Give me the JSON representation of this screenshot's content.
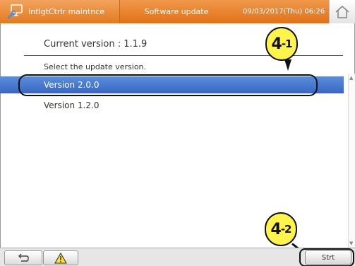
{
  "header": {
    "app_label": "IntlgtCtrlr maintnce",
    "screen_title": "Software update",
    "datetime": "09/03/2017(Thu) 06:26",
    "app_icon": "monitor-wrench-icon",
    "home_icon": "home-icon"
  },
  "main": {
    "current_version_text": "Current version : 1.1.9",
    "select_prompt": "Select the update version.",
    "versions": [
      {
        "label": "Version 2.0.0",
        "selected": true
      },
      {
        "label": "Version 1.2.0",
        "selected": false
      }
    ]
  },
  "annotations": {
    "callout_1": {
      "main": "4",
      "sub": "-1"
    },
    "callout_2": {
      "main": "4",
      "sub": "-2"
    },
    "callout_color": "#fff44a"
  },
  "footer": {
    "back_icon": "back-arrow-icon",
    "warning_icon": "warning-icon",
    "start_label": "Strt"
  },
  "colors": {
    "header_orange": "#e47a1e",
    "selected_blue": "#3767c4"
  }
}
